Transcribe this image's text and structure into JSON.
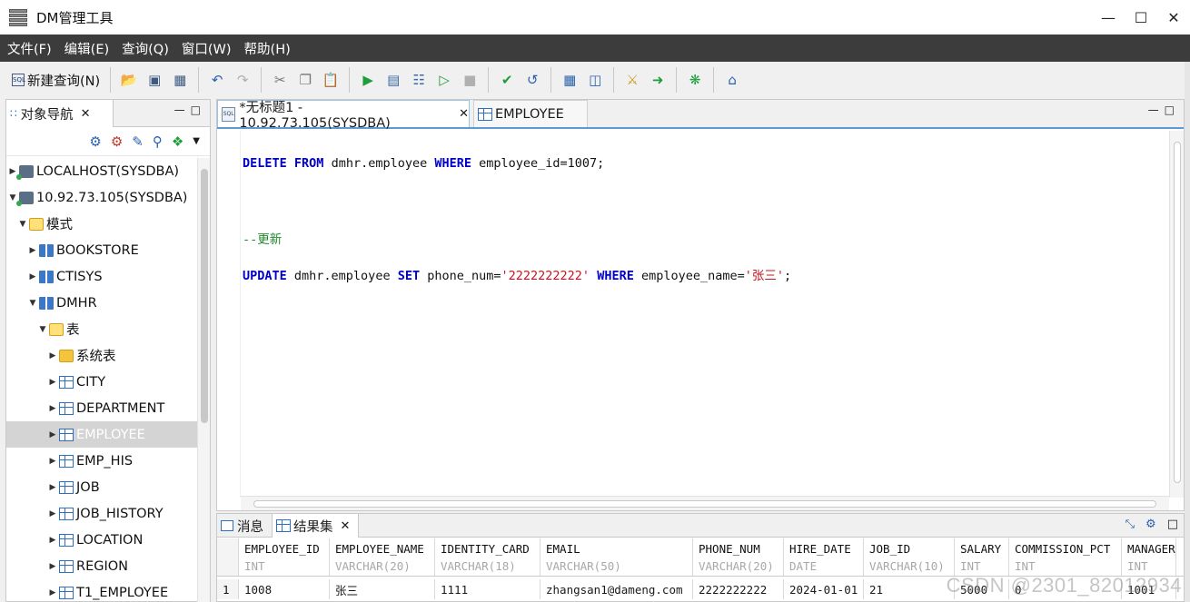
{
  "window": {
    "title": "DM管理工具"
  },
  "menu": [
    "文件(F)",
    "编辑(E)",
    "查询(Q)",
    "窗口(W)",
    "帮助(H)"
  ],
  "toolbar": {
    "new_query_label": "新建查询(N)"
  },
  "navigator": {
    "tab_label": "对象导航",
    "tree": [
      {
        "label": "LOCALHOST(SYSDBA)",
        "icon": "database-icon",
        "depth": 0,
        "expanded": false
      },
      {
        "label": "10.92.73.105(SYSDBA)",
        "icon": "database-icon",
        "depth": 0,
        "expanded": true
      },
      {
        "label": "模式",
        "icon": "folder-open-icon",
        "depth": 1,
        "expanded": true
      },
      {
        "label": "BOOKSTORE",
        "icon": "schema-icon",
        "depth": 2,
        "expanded": false
      },
      {
        "label": "CTISYS",
        "icon": "schema-icon",
        "depth": 2,
        "expanded": false
      },
      {
        "label": "DMHR",
        "icon": "schema-icon",
        "depth": 2,
        "expanded": true
      },
      {
        "label": "表",
        "icon": "folder-open-icon",
        "depth": 3,
        "expanded": true
      },
      {
        "label": "系统表",
        "icon": "folder-icon",
        "depth": 4,
        "expanded": false
      },
      {
        "label": "CITY",
        "icon": "table-icon",
        "depth": 4,
        "expanded": false
      },
      {
        "label": "DEPARTMENT",
        "icon": "table-icon",
        "depth": 4,
        "expanded": false
      },
      {
        "label": "EMPLOYEE",
        "icon": "table-icon",
        "depth": 4,
        "expanded": false,
        "selected": true
      },
      {
        "label": "EMP_HIS",
        "icon": "table-icon",
        "depth": 4,
        "expanded": false
      },
      {
        "label": "JOB",
        "icon": "table-icon",
        "depth": 4,
        "expanded": false
      },
      {
        "label": "JOB_HISTORY",
        "icon": "table-icon",
        "depth": 4,
        "expanded": false
      },
      {
        "label": "LOCATION",
        "icon": "table-icon",
        "depth": 4,
        "expanded": false
      },
      {
        "label": "REGION",
        "icon": "table-icon",
        "depth": 4,
        "expanded": false
      },
      {
        "label": "T1_EMPLOYEE",
        "icon": "table-icon",
        "depth": 4,
        "expanded": false
      }
    ]
  },
  "editor": {
    "tabs": [
      {
        "label": "*无标题1 - 10.92.73.105(SYSDBA)",
        "active": true
      },
      {
        "label": "EMPLOYEE",
        "active": false
      }
    ],
    "lines": [
      [
        {
          "t": "DELETE",
          "c": "kw"
        },
        {
          "t": " "
        },
        {
          "t": "FROM",
          "c": "kw"
        },
        {
          "t": " dmhr.employee "
        },
        {
          "t": "WHERE",
          "c": "kw"
        },
        {
          "t": " employee_id=1007;"
        }
      ],
      [
        {
          "t": "--更新",
          "c": "cmt"
        }
      ],
      [
        {
          "t": "UPDATE",
          "c": "kw"
        },
        {
          "t": " dmhr.employee "
        },
        {
          "t": "SET",
          "c": "kw"
        },
        {
          "t": " phone_num="
        },
        {
          "t": "'2222222222'",
          "c": "str"
        },
        {
          "t": " "
        },
        {
          "t": "WHERE",
          "c": "kw"
        },
        {
          "t": " employee_name="
        },
        {
          "t": "'张三'",
          "c": "str"
        },
        {
          "t": ";"
        }
      ]
    ]
  },
  "results": {
    "tabs": {
      "messages": "消息",
      "result_set": "结果集"
    },
    "columns": [
      {
        "name": "EMPLOYEE_ID",
        "type": "INT"
      },
      {
        "name": "EMPLOYEE_NAME",
        "type": "VARCHAR(20)"
      },
      {
        "name": "IDENTITY_CARD",
        "type": "VARCHAR(18)"
      },
      {
        "name": "EMAIL",
        "type": "VARCHAR(50)"
      },
      {
        "name": "PHONE_NUM",
        "type": "VARCHAR(20)"
      },
      {
        "name": "HIRE_DATE",
        "type": "DATE"
      },
      {
        "name": "JOB_ID",
        "type": "VARCHAR(10)"
      },
      {
        "name": "SALARY",
        "type": "INT"
      },
      {
        "name": "COMMISSION_PCT",
        "type": "INT"
      },
      {
        "name": "MANAGER_",
        "type": "INT"
      }
    ],
    "rows": [
      {
        "num": "1",
        "cells": [
          "1008",
          "张三",
          "1111",
          "zhangsan1@dameng.com",
          "2222222222",
          "2024-01-01",
          "21",
          "5000",
          "0",
          "1001"
        ]
      }
    ]
  },
  "watermark": "CSDN @2301_82012934"
}
